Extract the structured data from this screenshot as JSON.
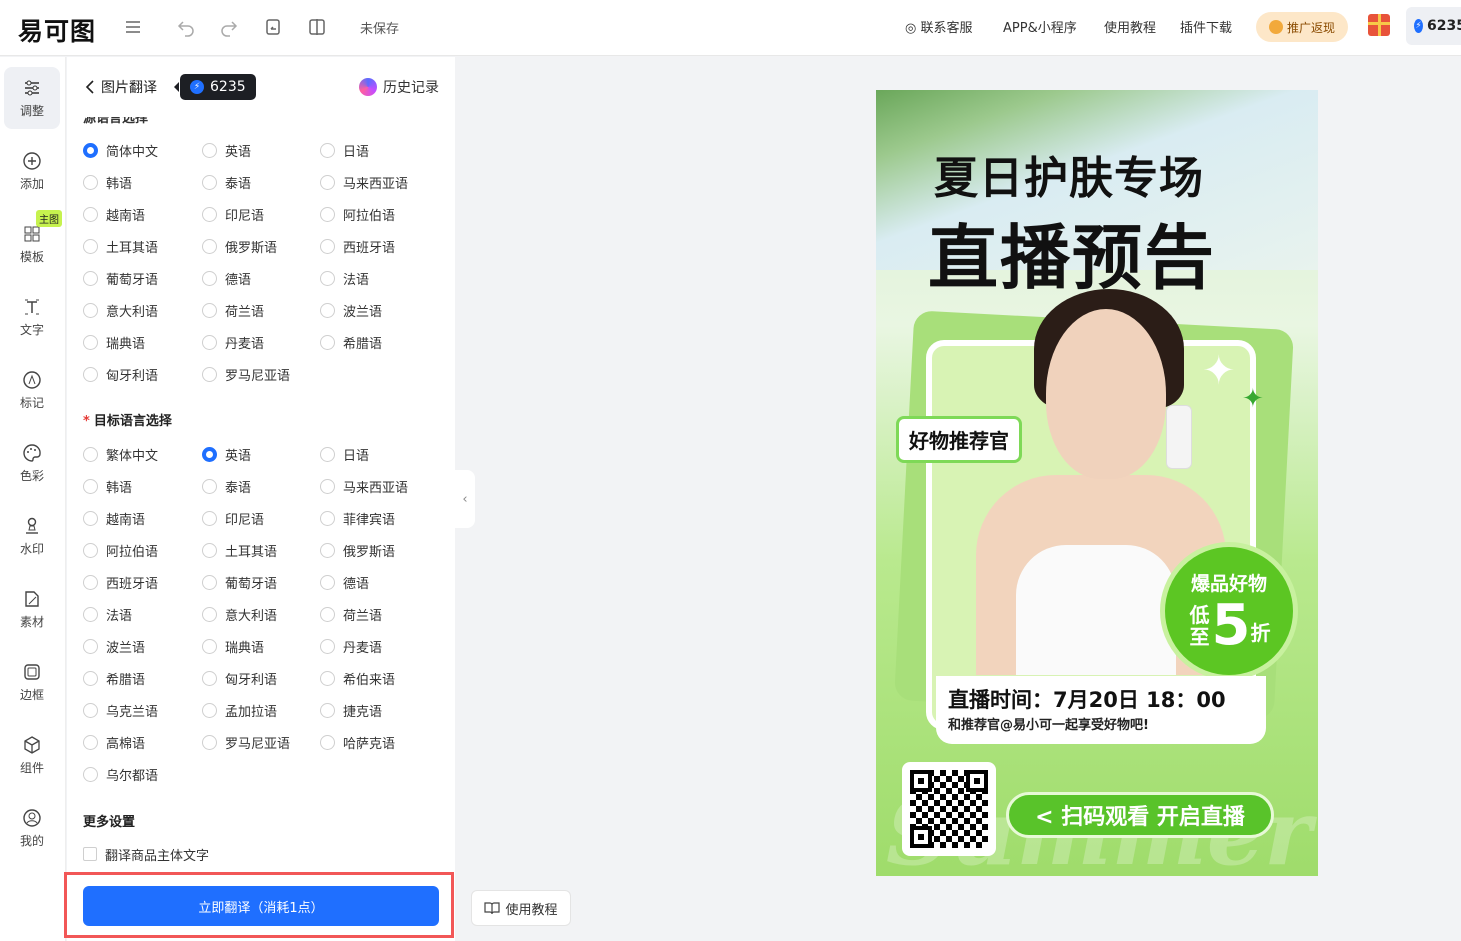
{
  "app": {
    "logo": "易可图",
    "status": "未保存"
  },
  "top_links": [
    "联系客服",
    "APP&小程序",
    "使用教程",
    "插件下载"
  ],
  "promo_label": "推广返现",
  "credits": "6235",
  "rail": [
    {
      "label": "调整",
      "icon": "sliders-icon"
    },
    {
      "label": "添加",
      "icon": "plus-circle-icon"
    },
    {
      "label": "模板",
      "icon": "grid-icon"
    },
    {
      "label": "文字",
      "icon": "text-icon"
    },
    {
      "label": "标记",
      "icon": "marker-icon"
    },
    {
      "label": "色彩",
      "icon": "palette-icon"
    },
    {
      "label": "水印",
      "icon": "stamp-icon"
    },
    {
      "label": "素材",
      "icon": "material-icon"
    },
    {
      "label": "边框",
      "icon": "frame-icon"
    },
    {
      "label": "组件",
      "icon": "cube-icon"
    },
    {
      "label": "我的",
      "icon": "user-icon"
    }
  ],
  "rail_tag": "主图",
  "panel": {
    "back_label": "图片翻译",
    "credits": "6235",
    "history": "历史记录",
    "source_title": "源语言选择",
    "source_options": [
      "简体中文",
      "英语",
      "日语",
      "韩语",
      "泰语",
      "马来西亚语",
      "越南语",
      "印尼语",
      "阿拉伯语",
      "土耳其语",
      "俄罗斯语",
      "西班牙语",
      "葡萄牙语",
      "德语",
      "法语",
      "意大利语",
      "荷兰语",
      "波兰语",
      "瑞典语",
      "丹麦语",
      "希腊语",
      "匈牙利语",
      "罗马尼亚语"
    ],
    "source_selected": "简体中文",
    "target_title": "目标语言选择",
    "target_options": [
      "繁体中文",
      "英语",
      "日语",
      "韩语",
      "泰语",
      "马来西亚语",
      "越南语",
      "印尼语",
      "菲律宾语",
      "阿拉伯语",
      "土耳其语",
      "俄罗斯语",
      "西班牙语",
      "葡萄牙语",
      "德语",
      "法语",
      "意大利语",
      "荷兰语",
      "波兰语",
      "瑞典语",
      "丹麦语",
      "希腊语",
      "匈牙利语",
      "希伯来语",
      "乌克兰语",
      "孟加拉语",
      "捷克语",
      "高棉语",
      "罗马尼亚语",
      "哈萨克语",
      "乌尔都语"
    ],
    "target_selected": "英语",
    "more_title": "更多设置",
    "checkbox_label": "翻译商品主体文字",
    "translate_button": "立即翻译（消耗1点）"
  },
  "tutorial_button": "使用教程",
  "poster": {
    "title_line1": "夏日护肤专场",
    "title_line2": "直播预告",
    "tag": "好物推荐官",
    "badge_line1": "爆品好物",
    "badge_small1": "低",
    "badge_small2": "至",
    "badge_number": "5",
    "badge_unit": "折",
    "time_line": "直播时间：7月20日 18：00",
    "sub_line": "和推荐官@易小可一起享受好物吧!",
    "scan_label": "< 扫码观看 开启直播",
    "watermark": "Summer"
  }
}
